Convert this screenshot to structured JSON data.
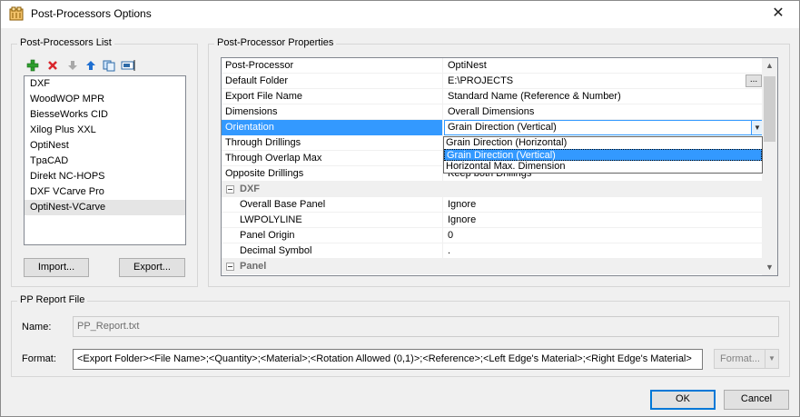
{
  "window": {
    "title": "Post-Processors Options",
    "close_glyph": "✕"
  },
  "list_group": {
    "label": "Post-Processors List",
    "toolbar": {
      "add_icon": "add-icon",
      "delete_icon": "delete-icon",
      "move_down_icon": "arrow-down-icon",
      "move_up_icon": "arrow-up-icon",
      "copy_icon": "copy-icon",
      "rename_icon": "rename-icon"
    },
    "items": [
      "DXF",
      "WoodWOP MPR",
      "BiesseWorks CID",
      "Xilog Plus XXL",
      "OptiNest",
      "TpaCAD",
      "Direkt NC-HOPS",
      "DXF VCarve Pro",
      "OptiNest-VCarve"
    ],
    "selected_index": 8,
    "import_label": "Import...",
    "export_label": "Export..."
  },
  "props_group": {
    "label": "Post-Processor Properties",
    "rows": [
      {
        "name": "Post-Processor",
        "value": "OptiNest"
      },
      {
        "name": "Default Folder",
        "value": "E:\\PROJECTS",
        "ellipsis": "..."
      },
      {
        "name": "Export File Name",
        "value": "Standard Name (Reference & Number)"
      },
      {
        "name": "Dimensions",
        "value": "Overall Dimensions"
      },
      {
        "name": "Orientation",
        "value": "Grain Direction (Vertical)"
      },
      {
        "name": "Through Drillings",
        "value": ""
      },
      {
        "name": "Through Overlap Max",
        "value": ""
      },
      {
        "name": "Opposite Drillings",
        "value": "Keep both Drillings"
      }
    ],
    "dxf_category": "DXF",
    "dxf_rows": [
      {
        "name": "Overall Base Panel",
        "value": "Ignore"
      },
      {
        "name": "LWPOLYLINE",
        "value": "Ignore"
      },
      {
        "name": "Panel Origin",
        "value": "0"
      },
      {
        "name": "Decimal Symbol",
        "value": "."
      }
    ],
    "panel_category": "Panel",
    "dropdown_options": [
      "Grain Direction (Horizontal)",
      "Grain Direction (Vertical)",
      "Horizontal Max. Dimension"
    ],
    "dropdown_selected": 1
  },
  "report_group": {
    "label": "PP Report File",
    "name_label": "Name:",
    "name_value": "PP_Report.txt",
    "format_label": "Format:",
    "format_value": "<Export Folder><File Name>;<Quantity>;<Material>;<Rotation Allowed (0,1)>;<Reference>;<Left Edge's Material>;<Right Edge's Material>",
    "format_button": "Format..."
  },
  "footer": {
    "ok_label": "OK",
    "cancel_label": "Cancel"
  },
  "colors": {
    "selection": "#3399ff",
    "default_button_border": "#0078d7"
  }
}
